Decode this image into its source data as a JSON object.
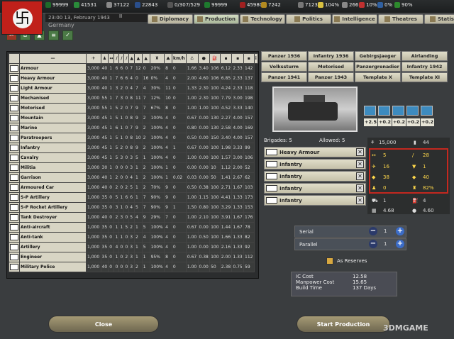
{
  "topbar": {
    "res": [
      {
        "v": "99999",
        "c": "#1f6a2a"
      },
      {
        "v": "41531",
        "c": "#2a8c3a"
      },
      {
        "v": "37122",
        "c": "#8a8a8a"
      },
      {
        "v": "22843",
        "c": "#2a4f8c"
      },
      {
        "v": "0/307/529",
        "c": "#555"
      },
      {
        "v": "99999",
        "c": "#1e7a2e"
      },
      {
        "v": "45980",
        "c": "#a02020"
      },
      {
        "v": "7242",
        "c": "#b38a20"
      },
      {
        "v": "7123",
        "c": "#777"
      },
      {
        "v": "104%",
        "c": "#d8c040"
      },
      {
        "v": "266",
        "c": "#888"
      },
      {
        "v": "10%",
        "c": "#c03030"
      },
      {
        "v": "0%",
        "c": "#3060a0"
      },
      {
        "v": "90%",
        "c": "#2d8a2d"
      }
    ]
  },
  "date": "23:00 13, February 1943",
  "speed": "II",
  "country": "Germany",
  "tabs": [
    "Diplomacy",
    "Production",
    "Technology",
    "Politics",
    "Intelligence",
    "Theatres",
    "Statistics"
  ],
  "columns_header": [
    "",
    "—",
    "✈",
    "♟",
    "↔",
    "/",
    "/",
    "/",
    "▲",
    "▲",
    "▲",
    "♜",
    "⛰",
    "km/h",
    "⚓",
    "●",
    "⛽",
    "▪",
    "▪",
    "▪",
    "i"
  ],
  "rows": [
    {
      "name": "Armour",
      "v": [
        "3,000",
        "40",
        "1",
        "6",
        "6",
        "0",
        "7",
        "12",
        "0",
        "20%",
        "8",
        "0",
        "1.66",
        "3.40",
        "106",
        "6.12",
        "2.33",
        "142"
      ]
    },
    {
      "name": "Heavy Armour",
      "v": [
        "3,000",
        "40",
        "1",
        "7",
        "6",
        "6",
        "4",
        "0",
        "16",
        "0%",
        "4",
        "0",
        "2.00",
        "4.60",
        "106",
        "6.85",
        "2.33",
        "137"
      ]
    },
    {
      "name": "Light Armour",
      "v": [
        "3,000",
        "40",
        "1",
        "3",
        "2",
        "0",
        "4",
        "7",
        "4",
        "30%",
        "11",
        "0",
        "1.33",
        "2.30",
        "100",
        "4.24",
        "2.33",
        "118"
      ]
    },
    {
      "name": "Mechanised",
      "v": [
        "3,000",
        "55",
        "1",
        "7",
        "3",
        "0",
        "8",
        "11",
        "7",
        "12%",
        "10",
        "0",
        "1.00",
        "2.30",
        "100",
        "7.79",
        "3.00",
        "198"
      ]
    },
    {
      "name": "Motorised",
      "v": [
        "3,000",
        "55",
        "1",
        "5",
        "2",
        "0",
        "7",
        "9",
        "7",
        "67%",
        "8",
        "0",
        "1.00",
        "1.00",
        "100",
        "4.52",
        "3.33",
        "140"
      ]
    },
    {
      "name": "Mountain",
      "v": [
        "3,000",
        "45",
        "1",
        "5",
        "1",
        "0",
        "8",
        "9",
        "2",
        "100%",
        "4",
        "0",
        "0.67",
        "0.00",
        "130",
        "2.27",
        "4.00",
        "157"
      ]
    },
    {
      "name": "Marine",
      "v": [
        "3,000",
        "45",
        "1",
        "6",
        "1",
        "0",
        "7",
        "9",
        "2",
        "100%",
        "4",
        "0",
        "0.80",
        "0.00",
        "130",
        "2.58",
        "4.00",
        "169"
      ]
    },
    {
      "name": "Paratroopers",
      "v": [
        "3,000",
        "45",
        "1",
        "5",
        "1",
        "0",
        "8",
        "10",
        "2",
        "100%",
        "4",
        "0",
        "0.50",
        "0.00",
        "150",
        "3.40",
        "4.00",
        "157"
      ]
    },
    {
      "name": "Infantry",
      "v": [
        "3,000",
        "45",
        "1",
        "5",
        "2",
        "0",
        "8",
        "9",
        "2",
        "100%",
        "4",
        "1",
        "0.67",
        "0.00",
        "100",
        "1.98",
        "3.33",
        "99"
      ]
    },
    {
      "name": "Cavalry",
      "v": [
        "3,000",
        "45",
        "1",
        "5",
        "3",
        "0",
        "3",
        "5",
        "1",
        "100%",
        "4",
        "0",
        "1.00",
        "0.00",
        "100",
        "1.57",
        "3.00",
        "106"
      ]
    },
    {
      "name": "Militia",
      "v": [
        "3,000",
        "30",
        "1",
        "0",
        "0",
        "0",
        "3",
        "1",
        "2",
        "100%",
        "1",
        "0",
        "0.00",
        "0.00",
        "10",
        "1.12",
        "2.00",
        "52"
      ]
    },
    {
      "name": "Garrison",
      "v": [
        "3,000",
        "40",
        "1",
        "2",
        "0",
        "0",
        "4",
        "1",
        "2",
        "100%",
        "1",
        "0.02",
        "0.03",
        "0.00",
        "50",
        "1.41",
        "2.67",
        "62"
      ]
    },
    {
      "name": "Armoured Car",
      "v": [
        "1,000",
        "40",
        "0",
        "2",
        "0",
        "2",
        "5",
        "1",
        "2",
        "70%",
        "9",
        "0",
        "0.50",
        "0.38",
        "100",
        "2.71",
        "1.67",
        "103"
      ]
    },
    {
      "name": "S-P Artillery",
      "v": [
        "1,000",
        "35",
        "0",
        "5",
        "1",
        "6",
        "6",
        "1",
        "7",
        "90%",
        "9",
        "0",
        "1.00",
        "1.15",
        "100",
        "4.41",
        "1.33",
        "173"
      ]
    },
    {
      "name": "S-P Rocket Artillery",
      "v": [
        "1,000",
        "35",
        "0",
        "3",
        "1",
        "0",
        "4",
        "5",
        "7",
        "90%",
        "9",
        "1",
        "1.50",
        "0.80",
        "100",
        "3.29",
        "1.33",
        "153"
      ]
    },
    {
      "name": "Tank Destroyer",
      "v": [
        "1,000",
        "40",
        "0",
        "2",
        "3",
        "0",
        "5",
        "4",
        "9",
        "29%",
        "7",
        "0",
        "1.00",
        "2.10",
        "100",
        "3.91",
        "1.67",
        "176"
      ]
    },
    {
      "name": "Anti-aircraft",
      "v": [
        "1,000",
        "35",
        "0",
        "1",
        "1",
        "5",
        "2",
        "1",
        "5",
        "100%",
        "4",
        "0",
        "0.67",
        "0.00",
        "100",
        "1.44",
        "1.67",
        "78"
      ]
    },
    {
      "name": "Anti-tank",
      "v": [
        "1,000",
        "35",
        "0",
        "1",
        "1",
        "0",
        "3",
        "2",
        "4",
        "100%",
        "4",
        "0",
        "1.00",
        "0.50",
        "100",
        "1.66",
        "1.33",
        "82"
      ]
    },
    {
      "name": "Artillery",
      "v": [
        "1,000",
        "35",
        "0",
        "4",
        "0",
        "0",
        "3",
        "1",
        "5",
        "100%",
        "4",
        "0",
        "1.00",
        "0.00",
        "100",
        "2.16",
        "1.33",
        "92"
      ]
    },
    {
      "name": "Engineer",
      "v": [
        "1,000",
        "35",
        "0",
        "1",
        "0",
        "2",
        "3",
        "1",
        "1",
        "95%",
        "8",
        "0",
        "0.67",
        "0.38",
        "100",
        "2.00",
        "1.33",
        "112"
      ]
    },
    {
      "name": "Military Police",
      "v": [
        "1,000",
        "40",
        "0",
        "0",
        "0",
        "0",
        "3",
        "2",
        "1",
        "100%",
        "4",
        "0",
        "1.00",
        "0.00",
        "50",
        "2.38",
        "0.75",
        "59"
      ]
    }
  ],
  "templates": [
    "Panzer 1936",
    "Infantry 1936",
    "Gebirgsjaeger",
    "Airlanding",
    "Volkssturm",
    "Motorised",
    "Panzergrenadier",
    "Infantry 1942",
    "Panzer 1941",
    "Panzer 1943",
    "Template X",
    "Template XI"
  ],
  "mods": [
    "+2.5",
    "+0.2",
    "+0.2",
    "+0.2",
    "+0.2"
  ],
  "brigades_label": "Brigades: 5",
  "allowed_label": "Allowed: 5",
  "brigade_slots": [
    "Heavy Armour",
    "Infantry",
    "Infantry",
    "Infantry",
    "Infantry"
  ],
  "stats": {
    "manpower": "15,000",
    "org": "44",
    "soft": "5",
    "hard": "28",
    "air": "16",
    "def": "1",
    "tough": "38",
    "supp": "40",
    "sp": "0",
    "eff": "82%",
    "speed": "1",
    "fuel": "4",
    "supply": "4.68",
    "consume": "4.60"
  },
  "serial_label": "Serial",
  "serial_val": "1",
  "parallel_label": "Parallel",
  "parallel_val": "1",
  "reserves_label": "As Reserves",
  "costs": [
    {
      "k": "IC Cost",
      "v": "12.58"
    },
    {
      "k": "Manpower Cost",
      "v": "15.65"
    },
    {
      "k": "Build Time",
      "v": "137 Days"
    }
  ],
  "close_label": "Close",
  "start_label": "Start Production",
  "watermark": "3DMGAME"
}
